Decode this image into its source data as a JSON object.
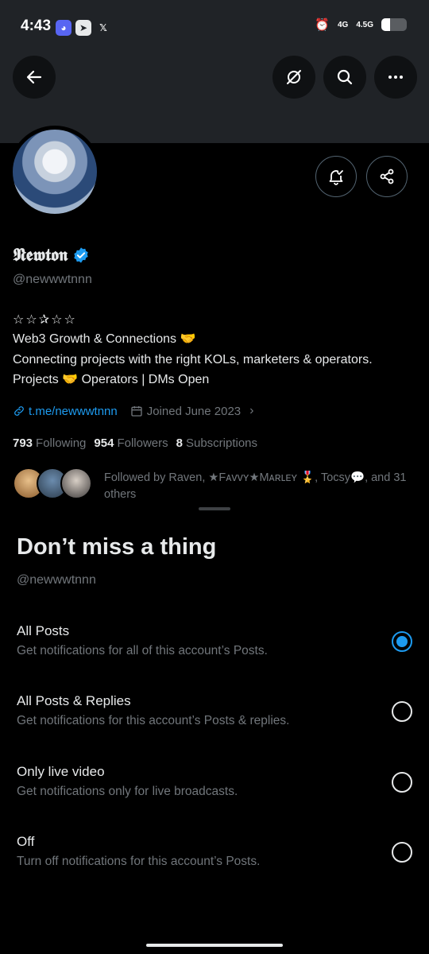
{
  "status_bar": {
    "time": "4:43",
    "apps": [
      "discord-icon",
      "telegram-icon",
      "x-icon"
    ],
    "network_1": "4G",
    "network_2": "4.5G",
    "battery_level": 0.35
  },
  "header": {
    "back_icon": "arrow-left-icon",
    "actions": [
      "grok-icon",
      "search-icon",
      "more-icon"
    ]
  },
  "profile": {
    "name": "𝕹𝖊𝖜𝖙𝖔𝖓",
    "handle": "@newwwtnnn",
    "stars": "☆☆✰☆☆",
    "bio_line1": "Web3 Growth & Connections 🤝",
    "bio_line2": "Connecting projects with the right KOLs, marketers & operators.",
    "bio_line3": "Projects 🤝 Operators | DMs Open",
    "link": "t.me/newwwtnnn",
    "joined": "Joined June 2023",
    "following_count": "793",
    "following_label": "Following",
    "followers_count": "954",
    "followers_label": "Followers",
    "subscriptions_count": "8",
    "subscriptions_label": "Subscriptions",
    "followed_by": "Followed by Raven, ★Fᴀᴠᴠʏ★Mᴀʀʟᴇʏ 🎖️, Tocsy💬, and 31 others"
  },
  "sheet": {
    "title": "Don’t miss a thing",
    "handle": "@newwwtnnn",
    "options": [
      {
        "label": "All Posts",
        "desc": "Get notifications for all of this account’s Posts.",
        "selected": true
      },
      {
        "label": "All Posts & Replies",
        "desc": "Get notifications for this account’s Posts & replies.",
        "selected": false
      },
      {
        "label": "Only live video",
        "desc": "Get notifications only for live broadcasts.",
        "selected": false
      },
      {
        "label": "Off",
        "desc": "Turn off notifications for this account’s Posts.",
        "selected": false
      }
    ]
  },
  "colors": {
    "accent": "#1d9bf0",
    "secondary_text": "#71767b",
    "primary_text": "#e7e9ea"
  }
}
